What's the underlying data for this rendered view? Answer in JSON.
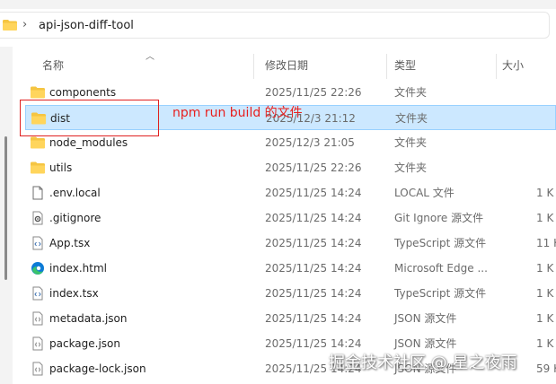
{
  "address": {
    "path": "api-json-diff-tool",
    "chevron": "›"
  },
  "columns": {
    "name": "名称",
    "modified": "修改日期",
    "type": "类型",
    "size": "大小"
  },
  "files": [
    {
      "name": "components",
      "modified": "2025/11/25 22:26",
      "type": "文件夹",
      "size": "",
      "icon": "folder-icon"
    },
    {
      "name": "dist",
      "modified": "2025/12/3 21:12",
      "type": "文件夹",
      "size": "",
      "icon": "folder-icon",
      "selected": true
    },
    {
      "name": "node_modules",
      "modified": "2025/12/3 21:05",
      "type": "文件夹",
      "size": "",
      "icon": "folder-icon"
    },
    {
      "name": "utils",
      "modified": "2025/11/25 22:26",
      "type": "文件夹",
      "size": "",
      "icon": "folder-icon"
    },
    {
      "name": ".env.local",
      "modified": "2025/11/25 14:24",
      "type": "LOCAL 文件",
      "size": "1 K",
      "icon": "file-icon"
    },
    {
      "name": ".gitignore",
      "modified": "2025/11/25 14:24",
      "type": "Git Ignore 源文件",
      "size": "1 K",
      "icon": "gear-file-icon"
    },
    {
      "name": "App.tsx",
      "modified": "2025/11/25 14:24",
      "type": "TypeScript 源文件",
      "size": "11 K",
      "icon": "code-file-icon"
    },
    {
      "name": "index.html",
      "modified": "2025/11/25 14:24",
      "type": "Microsoft Edge ...",
      "size": "1 K",
      "icon": "edge-icon"
    },
    {
      "name": "index.tsx",
      "modified": "2025/11/25 14:24",
      "type": "TypeScript 源文件",
      "size": "1 K",
      "icon": "code-file-icon"
    },
    {
      "name": "metadata.json",
      "modified": "2025/11/25 14:24",
      "type": "JSON 源文件",
      "size": "1 K",
      "icon": "json-file-icon"
    },
    {
      "name": "package.json",
      "modified": "2025/11/25 14:24",
      "type": "JSON 源文件",
      "size": "1 K",
      "icon": "json-file-icon"
    },
    {
      "name": "package-lock.json",
      "modified": "2025/11/25 14:24",
      "type": "JSON 源文件",
      "size": "59 K",
      "icon": "json-file-icon"
    }
  ],
  "annotation": {
    "text": "npm run build 的文件",
    "color": "#e02020"
  },
  "watermark": "掘金技术社区 @ 星之夜雨",
  "colors": {
    "folder": "#f5c542",
    "selection": "#cce8ff",
    "selection_border": "#99d1ff",
    "edge_blue": "#0c7bd6",
    "edge_green": "#3bc46b"
  }
}
